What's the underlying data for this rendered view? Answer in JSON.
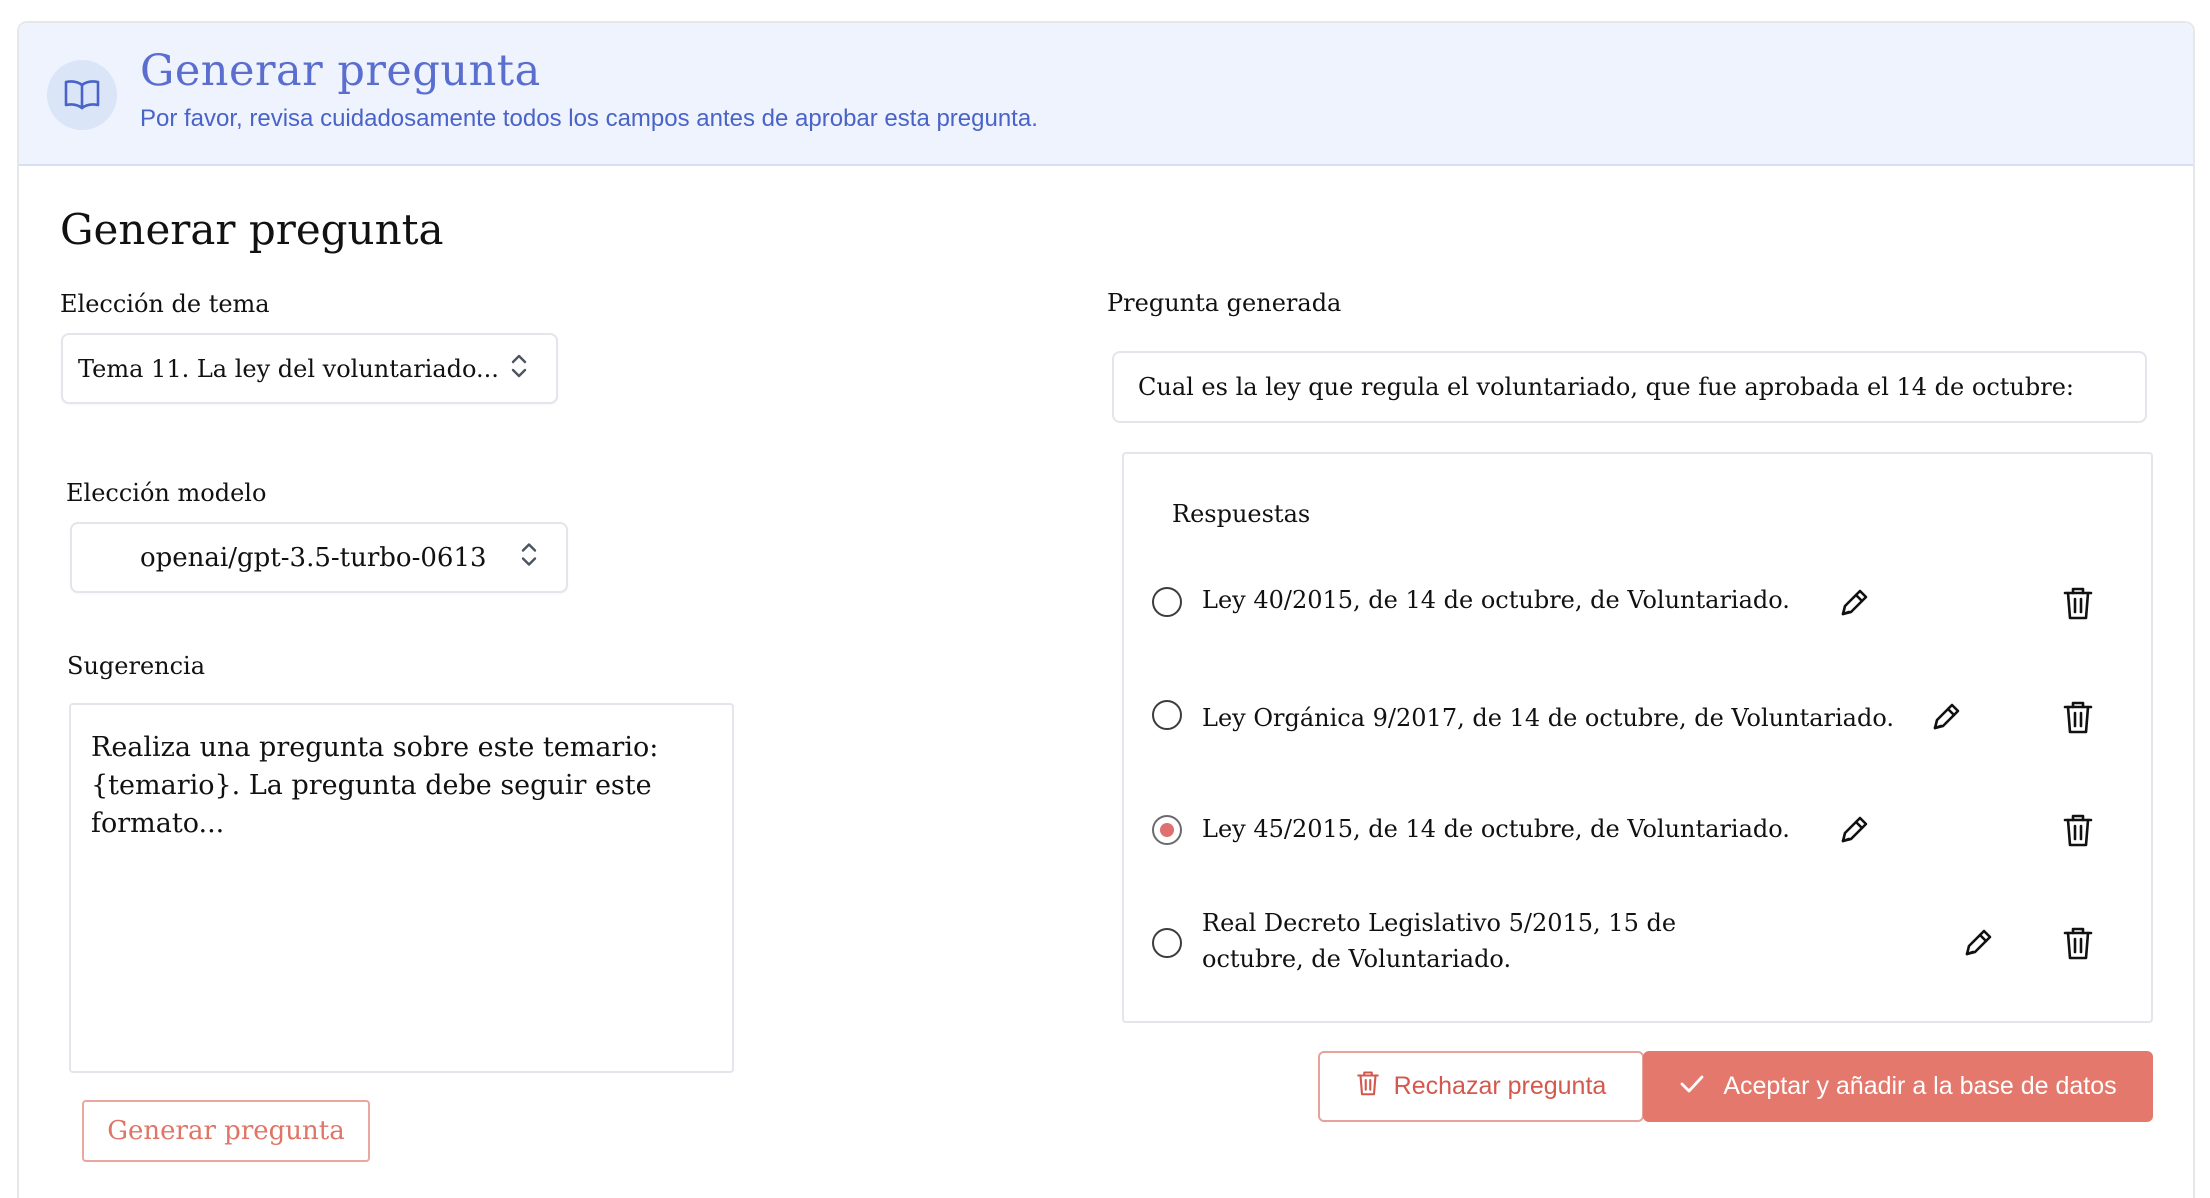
{
  "banner": {
    "icon": "book-open-icon",
    "title": "Generar pregunta",
    "subtitle": "Por favor, revisa cuidadosamente todos los campos antes de aprobar esta pregunta."
  },
  "form": {
    "title": "Generar pregunta",
    "topic_label": "Elección de tema",
    "topic_value": "Tema 11. La ley del voluntariado...",
    "model_label": "Elección modelo",
    "model_value": "openai/gpt-3.5-turbo-0613",
    "suggestion_label": "Sugerencia",
    "suggestion_value": "Realiza una pregunta sobre este temario: {temario}. La pregunta debe seguir este formato...",
    "generate_button": "Generar pregunta"
  },
  "result": {
    "question_label": "Pregunta generada",
    "question_value": "Cual es la ley que regula el voluntariado, que fue aprobada el 14 de octubre:",
    "answers_title": "Respuestas",
    "answers": [
      {
        "text": "Ley 40/2015, de 14 de octubre, de Voluntariado.",
        "selected": false
      },
      {
        "text": "Ley Orgánica 9/2017, de 14 de octubre, de Voluntariado.",
        "selected": false
      },
      {
        "text": "Ley 45/2015, de 14 de octubre, de Voluntariado.",
        "selected": true
      },
      {
        "text": "Real Decreto Legislativo 5/2015, 15 de octubre, de Voluntariado.",
        "selected": false
      }
    ],
    "reject_button": "Rechazar pregunta",
    "accept_button": "Aceptar y añadir a la base de datos"
  },
  "colors": {
    "accent_blue": "#5a6ecf",
    "accent_red": "#e4786c",
    "banner_bg": "#eef3fd"
  }
}
